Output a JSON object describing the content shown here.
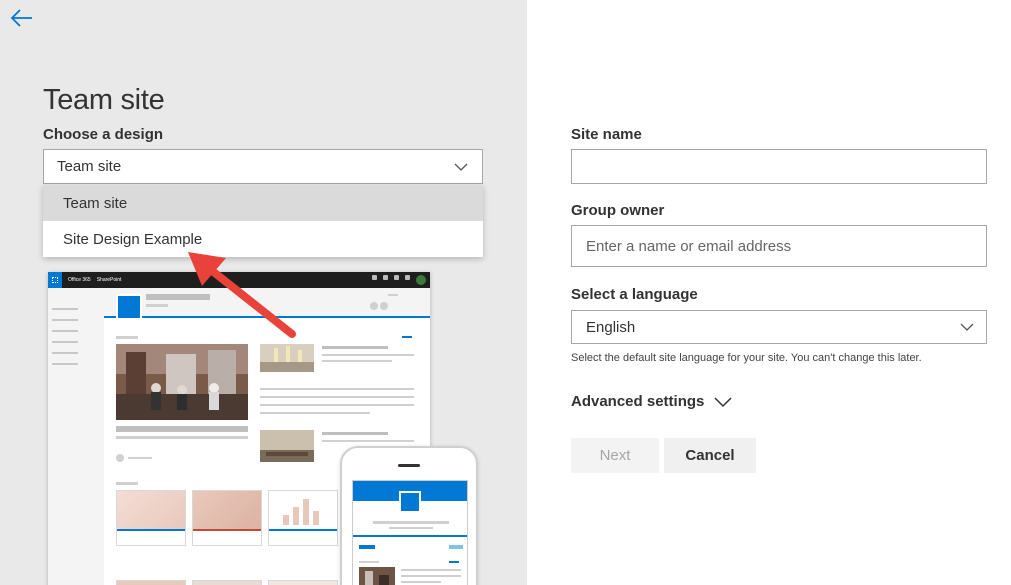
{
  "page": {
    "title": "Team site"
  },
  "design": {
    "label": "Choose a design",
    "selected": "Team site",
    "options": [
      "Team site",
      "Site Design Example"
    ]
  },
  "preview": {
    "bar_app": "Office 365",
    "bar_site": "SharePoint"
  },
  "form": {
    "site_name_label": "Site name",
    "site_name_value": "",
    "group_owner_label": "Group owner",
    "group_owner_placeholder": "Enter a name or email address",
    "language_label": "Select a language",
    "language_value": "English",
    "language_helper": "Select the default site language for your site. You can't change this later.",
    "advanced_label": "Advanced settings"
  },
  "buttons": {
    "next": "Next",
    "cancel": "Cancel"
  },
  "colors": {
    "accent": "#0078d4",
    "arrow": "#e8423a",
    "left_bg": "#e9e9e9"
  },
  "icons": {
    "back": "back-arrow-icon",
    "chevron": "chevron-down-icon",
    "waffle": "app-launcher-icon"
  }
}
